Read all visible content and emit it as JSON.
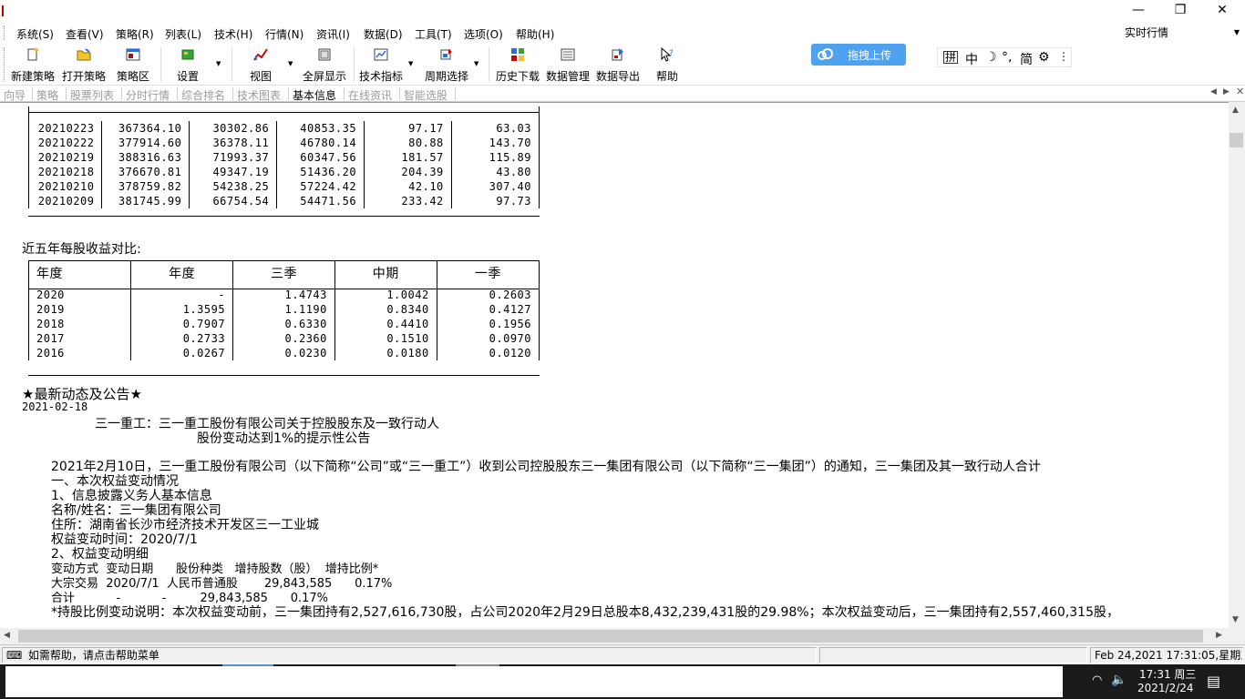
{
  "window": {
    "minimize": "—",
    "restore": "❐",
    "close": "✕"
  },
  "menu": {
    "items": [
      "系统(S)",
      "查看(V)",
      "策略(R)",
      "列表(L)",
      "技术(H)",
      "行情(N)",
      "资讯(I)",
      "数据(D)",
      "工具(T)",
      "选项(O)",
      "帮助(H)"
    ],
    "market_select": "实时行情"
  },
  "toolbar": {
    "buttons": [
      "新建策略",
      "打开策略",
      "策略区",
      "设置",
      "视图",
      "全屏显示",
      "技术指标",
      "周期选择",
      "历史下载",
      "数据管理",
      "数据导出",
      "帮助"
    ],
    "upload": "拖拽上传",
    "ime": [
      "拼",
      "中",
      "☽",
      "°,",
      "简",
      "⚙",
      "⋮"
    ]
  },
  "tabs": {
    "items": [
      "向导",
      "策略",
      "股票列表",
      "分时行情",
      "综合排名",
      "技术图表",
      "基本信息",
      "在线资讯",
      "智能选股"
    ],
    "active_index": 6
  },
  "content": {
    "top_table": {
      "rows": [
        [
          "20210223",
          "367364.10",
          "30302.86",
          "40853.35",
          "97.17",
          "63.03"
        ],
        [
          "20210222",
          "377914.60",
          "36378.11",
          "46780.14",
          "80.88",
          "143.70"
        ],
        [
          "20210219",
          "388316.63",
          "71993.37",
          "60347.56",
          "181.57",
          "115.89"
        ],
        [
          "20210218",
          "376670.81",
          "49347.19",
          "51436.20",
          "204.39",
          "43.80"
        ],
        [
          "20210210",
          "378759.82",
          "54238.25",
          "57224.42",
          "42.10",
          "307.40"
        ],
        [
          "20210209",
          "381745.99",
          "66754.54",
          "54471.56",
          "233.42",
          "97.73"
        ]
      ]
    },
    "eps_title": "近五年每股收益对比:",
    "eps_table": {
      "headers": [
        "年度",
        "年度",
        "三季",
        "中期",
        "一季"
      ],
      "rows": [
        [
          "2020",
          "-",
          "1.4743",
          "1.0042",
          "0.2603"
        ],
        [
          "2019",
          "1.3595",
          "1.1190",
          "0.8340",
          "0.4127"
        ],
        [
          "2018",
          "0.7907",
          "0.6330",
          "0.4410",
          "0.1956"
        ],
        [
          "2017",
          "0.2733",
          "0.2360",
          "0.1510",
          "0.0970"
        ],
        [
          "2016",
          "0.0267",
          "0.0230",
          "0.0180",
          "0.0120"
        ]
      ]
    },
    "news_title": "★最新动态及公告★",
    "news_date": "2021-02-18",
    "headline_1": "三一重工：三一重工股份有限公司关于控股股东及一致行动人",
    "headline_2": "股份变动达到1%的提示性公告",
    "para": "2021年2月10日，三一重工股份有限公司（以下简称“公司”或“三一重工”）收到公司控股股东三一集团有限公司（以下简称“三一集团”）的通知，三一集团及其一致行动人合计",
    "sec1": "一、本次权益变动情况",
    "sec1_1": "1、信息披露义务人基本信息",
    "name_line": "名称/姓名：三一集团有限公司",
    "addr_line": "住所：湖南省长沙市经济技术开发区三一工业城",
    "time_line": "权益变动时间：2020/7/1",
    "sec1_2": "2、权益变动明细",
    "detail_header": "变动方式  变动日期      股份种类   增持股数（股）  增持比例*",
    "detail_row1": "大宗交易  2020/7/1  人民币普通股       29,843,585      0.17%",
    "detail_row2": "合计           -           -         29,843,585      0.17%",
    "note": "*持股比例变动说明：本次权益变动前，三一集团持有2,527,616,730股，占公司2020年2月29日总股本8,432,239,431股的29.98%；本次权益变动后，三一集团持有2,557,460,315股，"
  },
  "status": {
    "help": "如需帮助，请点击帮助菜单",
    "datetime": "Feb 24,2021 17:31:05,星期三"
  },
  "taskbar": {
    "time": "17:31 周三",
    "date": "2021/2/24"
  }
}
